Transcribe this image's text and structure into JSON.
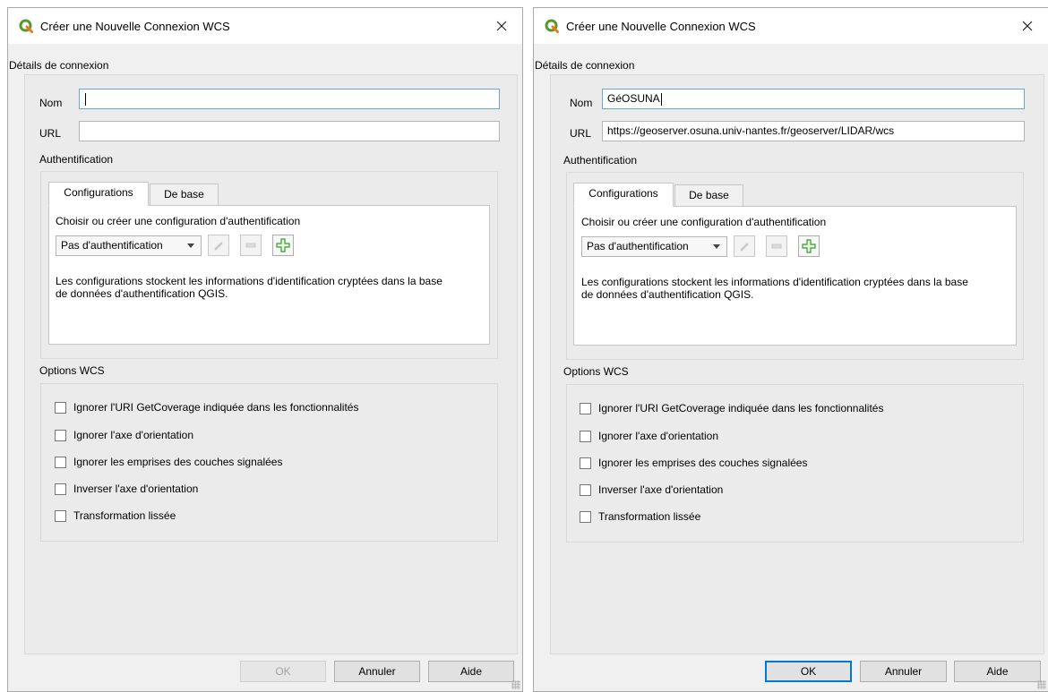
{
  "dialogs": [
    {
      "title": "Créer une Nouvelle Connexion WCS",
      "connection_section": "Détails de connexion",
      "name_label": "Nom",
      "name_value": "",
      "url_label": "URL",
      "url_value": "",
      "auth_section": "Authentification",
      "tabs": [
        "Configurations",
        "De base"
      ],
      "auth_prompt": "Choisir ou créer une configuration d'authentification",
      "auth_combo": "Pas d'authentification",
      "auth_info_line1": "Les configurations stockent les informations d'identification cryptées dans la base",
      "auth_info_line2": "de données d'authentification QGIS.",
      "options_section": "Options WCS",
      "options": [
        "Ignorer l'URI GetCoverage indiquée dans les fonctionnalités",
        "Ignorer l'axe d'orientation",
        "Ignorer les emprises des couches signalées",
        "Inverser l'axe d'orientation",
        "Transformation lissée"
      ],
      "buttons": {
        "ok": "OK",
        "cancel": "Annuler",
        "help": "Aide"
      }
    },
    {
      "title": "Créer une Nouvelle Connexion WCS",
      "connection_section": "Détails de connexion",
      "name_label": "Nom",
      "name_value": "GéOSUNA",
      "url_label": "URL",
      "url_value": "https://geoserver.osuna.univ-nantes.fr/geoserver/LIDAR/wcs",
      "auth_section": "Authentification",
      "tabs": [
        "Configurations",
        "De base"
      ],
      "auth_prompt": "Choisir ou créer une configuration d'authentification",
      "auth_combo": "Pas d'authentification",
      "auth_info_line1": "Les configurations stockent les informations d'identification cryptées dans la base",
      "auth_info_line2": "de données d'authentification QGIS.",
      "options_section": "Options WCS",
      "options": [
        "Ignorer l'URI GetCoverage indiquée dans les fonctionnalités",
        "Ignorer l'axe d'orientation",
        "Ignorer les emprises des couches signalées",
        "Inverser l'axe d'orientation",
        "Transformation lissée"
      ],
      "buttons": {
        "ok": "OK",
        "cancel": "Annuler",
        "help": "Aide"
      }
    }
  ],
  "icons": {
    "app": "qgis-logo-icon",
    "close": "close-icon",
    "edit": "pencil-icon",
    "remove": "remove-icon",
    "add": "add-plus-icon"
  },
  "colors": {
    "qgis_green": "#589632",
    "qgis_yellow": "#ee7913",
    "focus_blue": "#0078d7",
    "add_green": "#3a9a2f"
  }
}
